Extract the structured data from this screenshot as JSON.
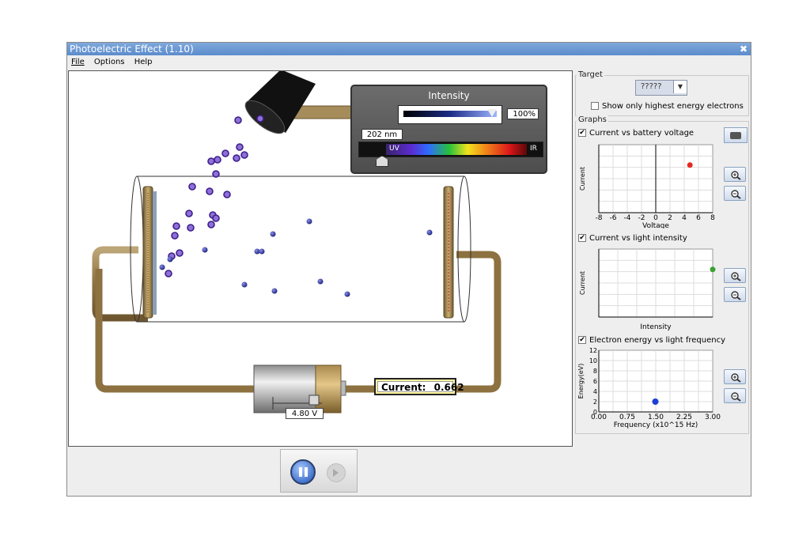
{
  "window": {
    "title": "Photoelectric Effect (1.10)"
  },
  "menu": [
    "File",
    "Options",
    "Help"
  ],
  "intensity_panel": {
    "title": "Intensity",
    "value": "100%",
    "wavelength": "202 nm",
    "uv_label": "UV",
    "ir_label": "IR"
  },
  "battery": {
    "voltage": "4.80 V"
  },
  "current": {
    "label": "Current:",
    "value": "0.662"
  },
  "target": {
    "group_label": "Target",
    "selected": "?????",
    "highest_energy_label": "Show only highest energy electrons"
  },
  "graphs": {
    "group_label": "Graphs",
    "g1": {
      "title": "Current vs battery voltage",
      "xlabel": "Voltage",
      "ylabel": "Current",
      "ticks": [
        "-8",
        "-6",
        "-4",
        "-2",
        "0",
        "2",
        "4",
        "6",
        "8"
      ],
      "point": {
        "x": 4.8,
        "y": 0.662
      },
      "point_color": "#e8281f"
    },
    "g2": {
      "title": "Current vs light intensity",
      "xlabel": "Intensity",
      "ylabel": "Current",
      "point": {
        "x": 100,
        "y": 0.662
      },
      "point_color": "#3aa035"
    },
    "g3": {
      "title": "Electron energy vs light frequency",
      "xlabel": "Frequency (x10^15 Hz)",
      "ylabel": "Energy(eV)",
      "xticks": [
        "0.00",
        "0.75",
        "1.50",
        "2.25",
        "3.00"
      ],
      "yticks": [
        "12",
        "10",
        "8",
        "6",
        "4",
        "2",
        "0"
      ],
      "point": {
        "x": 1.49,
        "y": 2.0
      },
      "point_color": "#1c3fd6"
    }
  }
}
